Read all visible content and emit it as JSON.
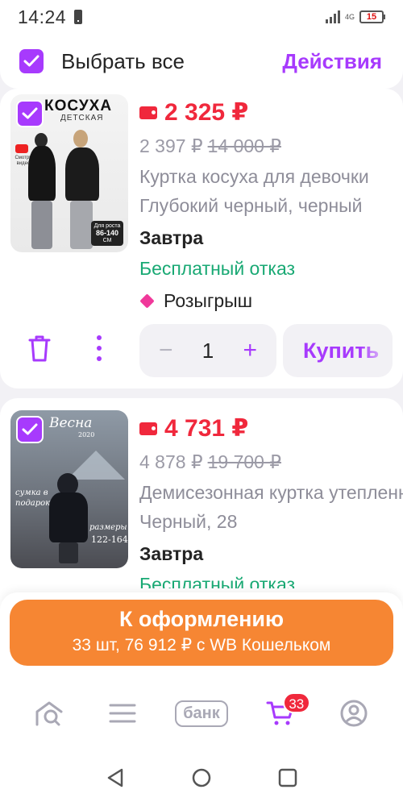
{
  "status_bar": {
    "time": "14:24",
    "network": "4G",
    "battery": "15"
  },
  "header": {
    "select_all_label": "Выбрать все",
    "actions_label": "Действия",
    "select_all_checked": true
  },
  "items": [
    {
      "image_brand": "КОСУХА",
      "image_sub": "ДЕТСКАЯ",
      "image_video_label": "Смотри видео",
      "image_size_label": "Для роста",
      "image_size": "86-140",
      "image_size_unit": "СМ",
      "checked": true,
      "price": "2 325 ₽",
      "price_without_wallet": "2 397 ₽",
      "price_old": "14 000 ₽",
      "title": "Куртка косуха для девочки",
      "variant": "Глубокий черный, черный",
      "delivery": "Завтра",
      "refund": "Бесплатный отказ",
      "promo": "Розыгрыш",
      "quantity": "1",
      "buy_label": "Купить"
    },
    {
      "image_script_top": "Весна",
      "image_year": "2020",
      "image_script_mid": "сумка в подарок",
      "image_size_label": "размеры",
      "image_size": "122-164",
      "checked": true,
      "price": "4 731 ₽",
      "price_without_wallet": "4 878 ₽",
      "price_old": "19 700 ₽",
      "title": "Демисезонная куртка утепленная",
      "variant": "Черный, 28",
      "delivery": "Завтра",
      "refund": "Бесплатный отказ"
    }
  ],
  "checkout": {
    "label": "К оформлению",
    "summary": "33 шт, 76 912 ₽ с WB Кошельком"
  },
  "bottom_nav": {
    "bank_label": "банк",
    "cart_count": "33"
  },
  "colors": {
    "accent": "#a73afd",
    "price": "#f0283c",
    "refund": "#19a974",
    "checkout": "#f68633"
  }
}
